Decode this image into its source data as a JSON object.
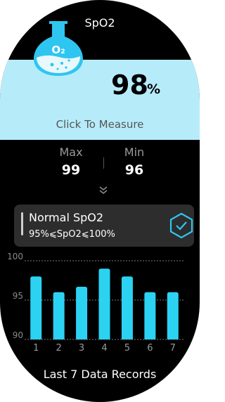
{
  "header": {
    "title": "SpO2"
  },
  "hero": {
    "flask_label": "O₂",
    "value": "98",
    "unit": "%",
    "measure_label": "Click To Measure"
  },
  "stats": {
    "max_label": "Max",
    "max_value": "99",
    "min_label": "Min",
    "min_value": "96"
  },
  "status_card": {
    "title": "Normal SpO2",
    "range": "95%⩽SpO2⩽100%"
  },
  "footer": {
    "label": "Last 7 Data Records"
  },
  "colors": {
    "bar": "#2cd2f2",
    "hero_bg": "#b6ecfa",
    "check": "#2ec6f0"
  },
  "chart_data": {
    "type": "bar",
    "categories": [
      "1",
      "2",
      "3",
      "4",
      "5",
      "6",
      "7"
    ],
    "values": [
      98,
      96,
      96.7,
      99,
      98,
      96,
      96
    ],
    "yticks": [
      "100",
      "95",
      "90"
    ],
    "ylim": [
      90,
      100
    ],
    "grid": true
  }
}
